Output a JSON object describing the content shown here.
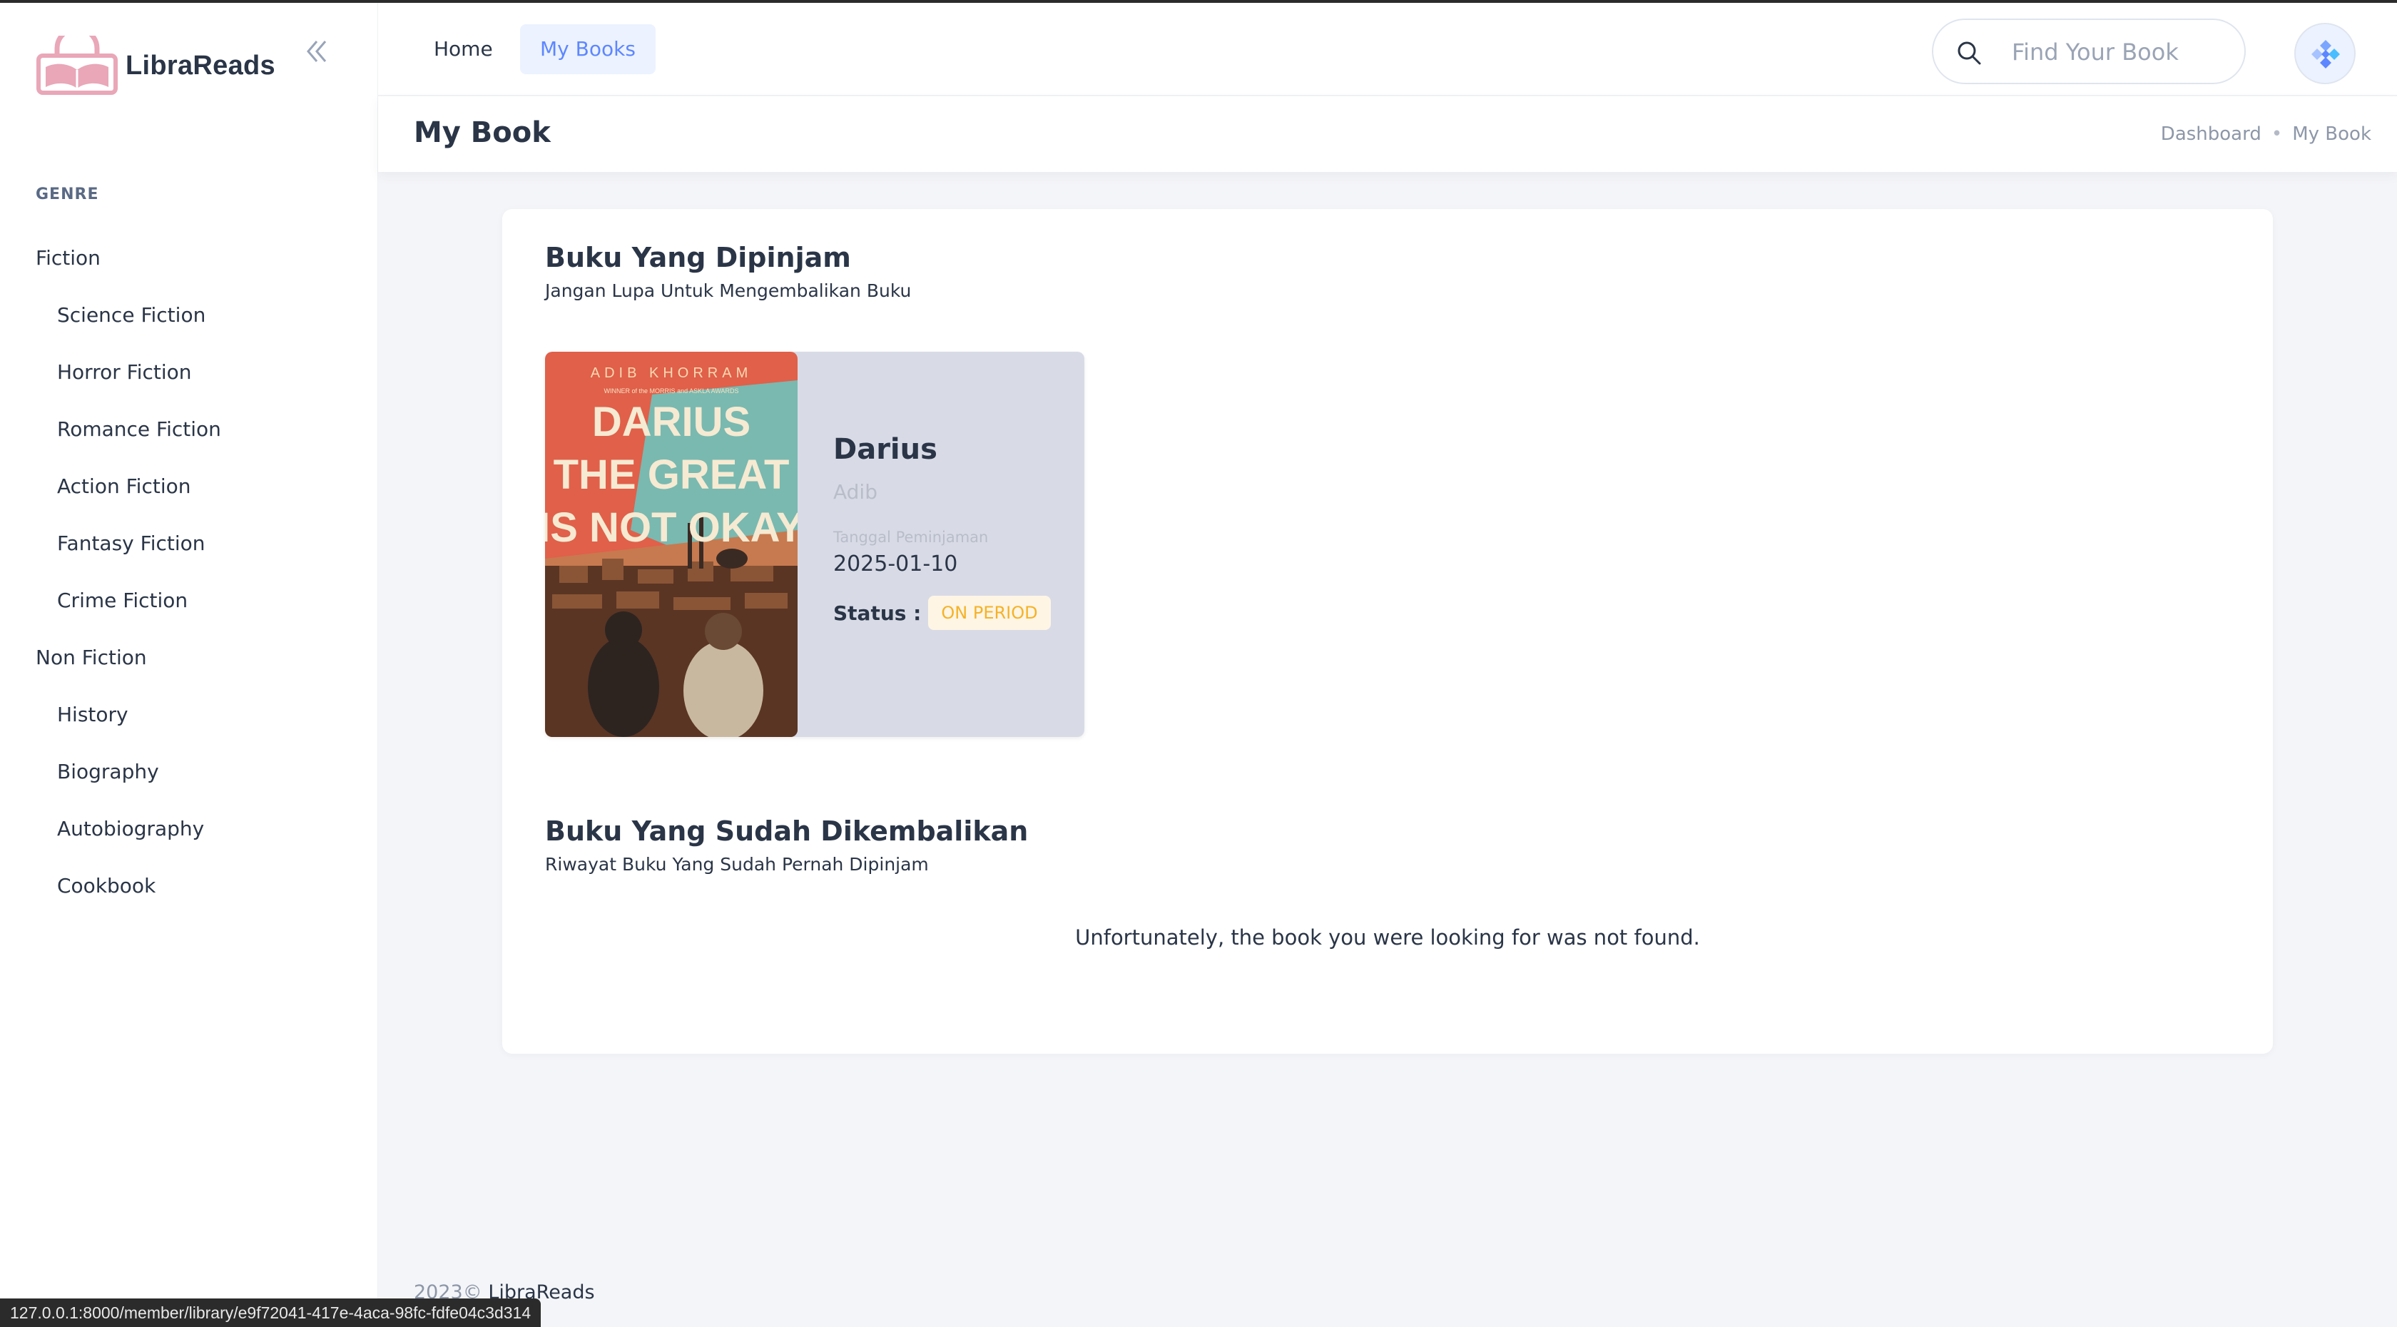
{
  "app": {
    "name": "LibraReads"
  },
  "sidebar": {
    "caption": "GENRE",
    "items": [
      {
        "label": "Fiction",
        "level": "parent"
      },
      {
        "label": "Science Fiction",
        "level": "child"
      },
      {
        "label": "Horror Fiction",
        "level": "child"
      },
      {
        "label": "Romance Fiction",
        "level": "child"
      },
      {
        "label": "Action Fiction",
        "level": "child"
      },
      {
        "label": "Fantasy Fiction",
        "level": "child"
      },
      {
        "label": "Crime Fiction",
        "level": "child"
      },
      {
        "label": "Non Fiction",
        "level": "parent"
      },
      {
        "label": "History",
        "level": "child"
      },
      {
        "label": "Biography",
        "level": "child"
      },
      {
        "label": "Autobiography",
        "level": "child"
      },
      {
        "label": "Cookbook",
        "level": "child"
      }
    ]
  },
  "header": {
    "tabs": [
      {
        "label": "Home",
        "active": false
      },
      {
        "label": "My Books",
        "active": true
      }
    ],
    "search": {
      "placeholder": "Find Your Book",
      "value": ""
    }
  },
  "page": {
    "title": "My Book",
    "breadcrumb": [
      "Dashboard",
      "My Book"
    ]
  },
  "borrowed": {
    "title": "Buku Yang Dipinjam",
    "subtitle": "Jangan Lupa Untuk Mengembalikan Buku",
    "book": {
      "title": "Darius",
      "author": "Adib",
      "date_label": "Tanggal Peminjaman",
      "date": "2025-01-10",
      "status_label": "Status :",
      "status": "ON PERIOD",
      "cover": {
        "author_line": "ADIB KHORRAM",
        "award_line": "WINNER of the MORRIS and ASKLA AWARDS",
        "title_lines": [
          "DARIUS",
          "THE GREAT",
          "IS NOT OKAY"
        ]
      }
    }
  },
  "returned": {
    "title": "Buku Yang Sudah Dikembalikan",
    "subtitle": "Riwayat Buku Yang Sudah Pernah Dipinjam",
    "empty_message": "Unfortunately, the book you were looking for was not found."
  },
  "footer": {
    "year": "2023©",
    "brand": "LibraReads"
  },
  "status_bar": {
    "url": "127.0.0.1:8000/member/library/e9f72041-417e-4aca-98fc-fdfe04c3d314"
  },
  "colors": {
    "primary": "#5d87ff",
    "primary_light": "#ecf2ff",
    "warning": "#f5b227",
    "warning_light": "#fef5e5",
    "logo_pink": "#e9a7b8",
    "text_dark": "#2a3547"
  },
  "icons": {
    "logo": "library-logo-icon",
    "collapse": "double-chevron-left-icon",
    "search": "search-icon",
    "avatar": "diamond-avatar-icon"
  }
}
